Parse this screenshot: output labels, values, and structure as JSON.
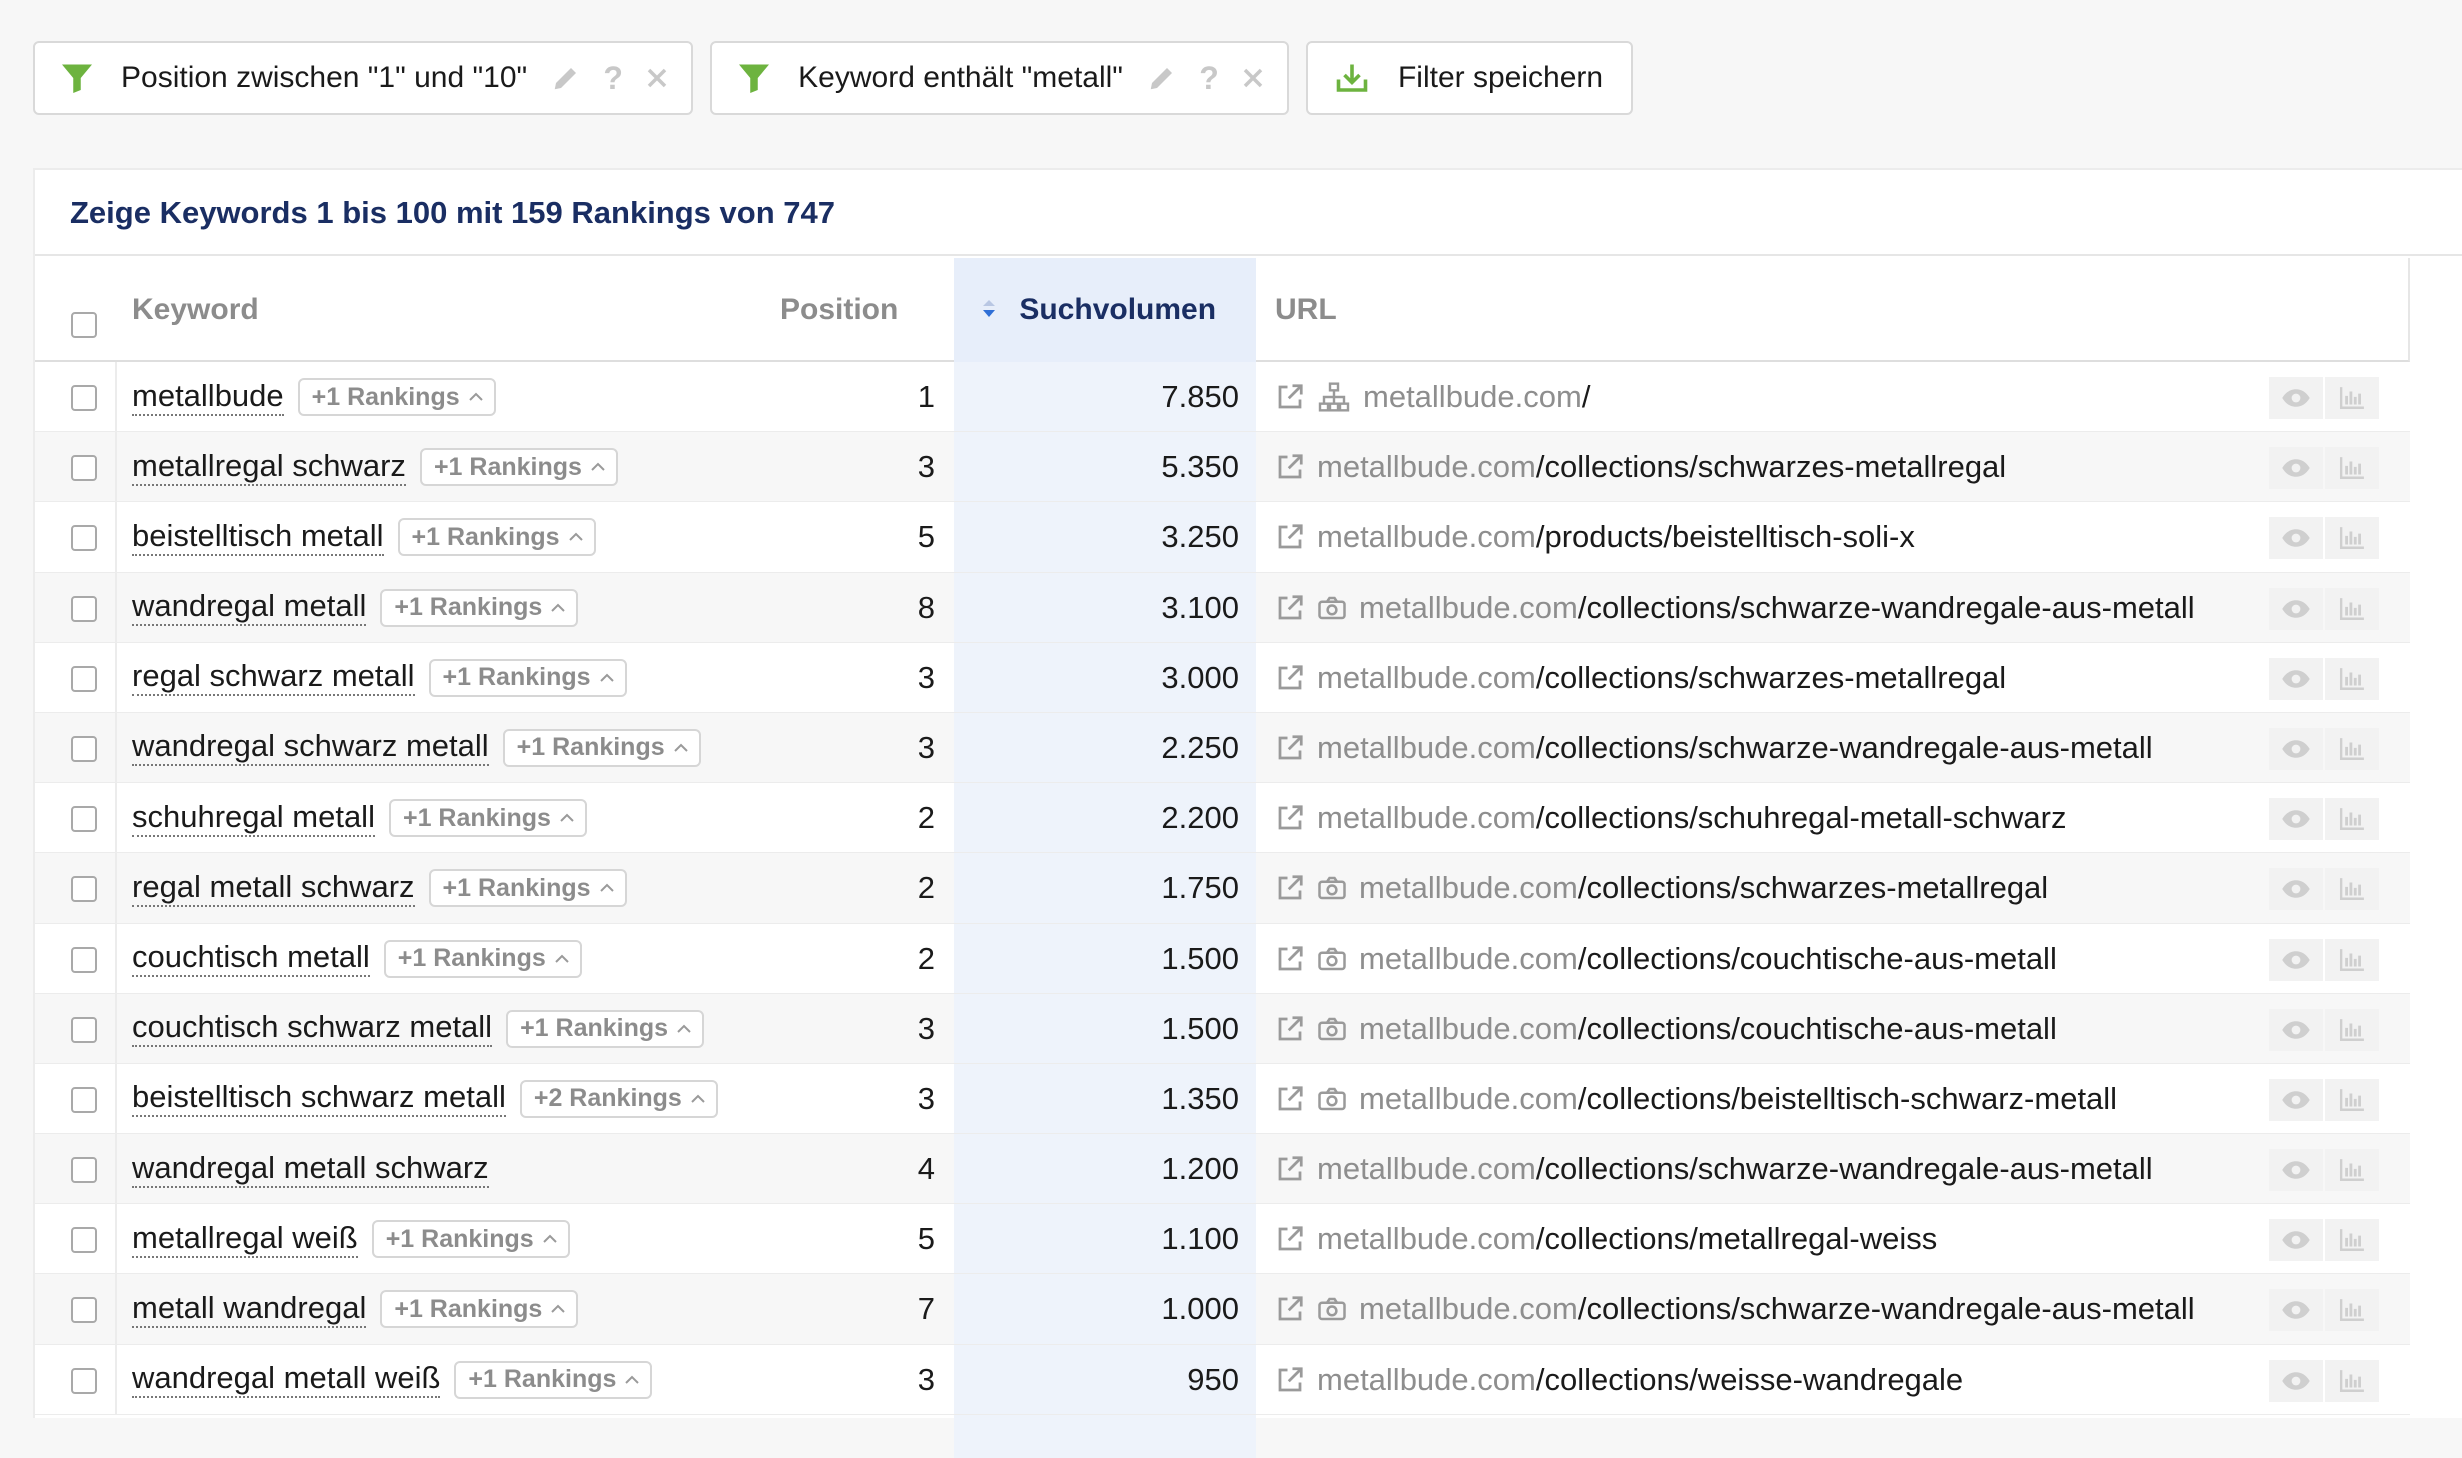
{
  "filters": [
    {
      "label": "Position zwischen \"1\" und \"10\"",
      "icon": "funnel-icon"
    },
    {
      "label": "Keyword enthält \"metall\"",
      "icon": "funnel-icon"
    }
  ],
  "filter_help": "?",
  "save_filter_label": "Filter speichern",
  "summary": "Zeige Keywords 1 bis 100 mit 159 Rankings von 747",
  "columns": {
    "keyword": "Keyword",
    "position": "Position",
    "suchvolumen": "Suchvolumen",
    "url": "URL"
  },
  "colors": {
    "accent_green": "#6db33f",
    "title_blue": "#1a2e63",
    "sort_blue": "#2f6fd6"
  },
  "rows": [
    {
      "keyword": "metallbude",
      "rankings": "+1 Rankings",
      "position": "1",
      "volume": "7.850",
      "domain": "metallbude.com",
      "path": "/",
      "icon": "sitemap-icon"
    },
    {
      "keyword": "metallregal schwarz",
      "rankings": "+1 Rankings",
      "position": "3",
      "volume": "5.350",
      "domain": "metallbude.com",
      "path": "/collections/schwarzes-metallregal",
      "icon": ""
    },
    {
      "keyword": "beistelltisch metall",
      "rankings": "+1 Rankings",
      "position": "5",
      "volume": "3.250",
      "domain": "metallbude.com",
      "path": "/products/beistelltisch-soli-x",
      "icon": ""
    },
    {
      "keyword": "wandregal metall",
      "rankings": "+1 Rankings",
      "position": "8",
      "volume": "3.100",
      "domain": "metallbude.com",
      "path": "/collections/schwarze-wandregale-aus-metall",
      "icon": "camera-icon"
    },
    {
      "keyword": "regal schwarz metall",
      "rankings": "+1 Rankings",
      "position": "3",
      "volume": "3.000",
      "domain": "metallbude.com",
      "path": "/collections/schwarzes-metallregal",
      "icon": ""
    },
    {
      "keyword": "wandregal schwarz metall",
      "rankings": "+1 Rankings",
      "position": "3",
      "volume": "2.250",
      "domain": "metallbude.com",
      "path": "/collections/schwarze-wandregale-aus-metall",
      "icon": ""
    },
    {
      "keyword": "schuhregal metall",
      "rankings": "+1 Rankings",
      "position": "2",
      "volume": "2.200",
      "domain": "metallbude.com",
      "path": "/collections/schuhregal-metall-schwarz",
      "icon": ""
    },
    {
      "keyword": "regal metall schwarz",
      "rankings": "+1 Rankings",
      "position": "2",
      "volume": "1.750",
      "domain": "metallbude.com",
      "path": "/collections/schwarzes-metallregal",
      "icon": "camera-icon"
    },
    {
      "keyword": "couchtisch metall",
      "rankings": "+1 Rankings",
      "position": "2",
      "volume": "1.500",
      "domain": "metallbude.com",
      "path": "/collections/couchtische-aus-metall",
      "icon": "camera-icon"
    },
    {
      "keyword": "couchtisch schwarz metall",
      "rankings": "+1 Rankings",
      "position": "3",
      "volume": "1.500",
      "domain": "metallbude.com",
      "path": "/collections/couchtische-aus-metall",
      "icon": "camera-icon"
    },
    {
      "keyword": "beistelltisch schwarz metall",
      "rankings": "+2 Rankings",
      "position": "3",
      "volume": "1.350",
      "domain": "metallbude.com",
      "path": "/collections/beistelltisch-schwarz-metall",
      "icon": "camera-icon"
    },
    {
      "keyword": "wandregal metall schwarz",
      "rankings": "",
      "position": "4",
      "volume": "1.200",
      "domain": "metallbude.com",
      "path": "/collections/schwarze-wandregale-aus-metall",
      "icon": ""
    },
    {
      "keyword": "metallregal weiß",
      "rankings": "+1 Rankings",
      "position": "5",
      "volume": "1.100",
      "domain": "metallbude.com",
      "path": "/collections/metallregal-weiss",
      "icon": ""
    },
    {
      "keyword": "metall wandregal",
      "rankings": "+1 Rankings",
      "position": "7",
      "volume": "1.000",
      "domain": "metallbude.com",
      "path": "/collections/schwarze-wandregale-aus-metall",
      "icon": "camera-icon"
    },
    {
      "keyword": "wandregal metall weiß",
      "rankings": "+1 Rankings",
      "position": "3",
      "volume": "950",
      "domain": "metallbude.com",
      "path": "/collections/weisse-wandregale",
      "icon": ""
    }
  ]
}
